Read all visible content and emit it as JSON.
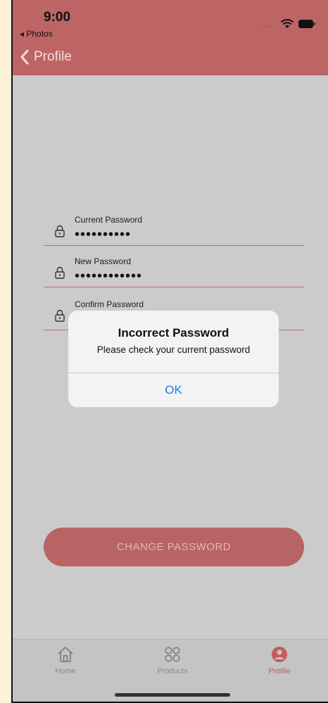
{
  "status_bar": {
    "time": "9:00",
    "back_app": "◂ Photos",
    "signal": "....."
  },
  "nav": {
    "back_label": "Profile"
  },
  "form": {
    "fields": [
      {
        "label": "Current Password",
        "value": "••••••••••"
      },
      {
        "label": "New Password",
        "value": "••••••••••••"
      },
      {
        "label": "Confirm Password",
        "value": ""
      }
    ]
  },
  "alert": {
    "title": "Incorrect Password",
    "message": "Please check your current password",
    "ok_label": "OK"
  },
  "actions": {
    "change_password_label": "CHANGE PASSWORD"
  },
  "tabbar": {
    "tabs": [
      {
        "label": "Home",
        "icon": "home-icon"
      },
      {
        "label": "Products",
        "icon": "products-grid-icon"
      },
      {
        "label": "Profile",
        "icon": "profile-icon",
        "active": true
      }
    ]
  },
  "colors": {
    "accent": "#bd6565",
    "button": "#b86464",
    "link_blue": "#1a7ee6",
    "background": "#cbcbcb"
  }
}
